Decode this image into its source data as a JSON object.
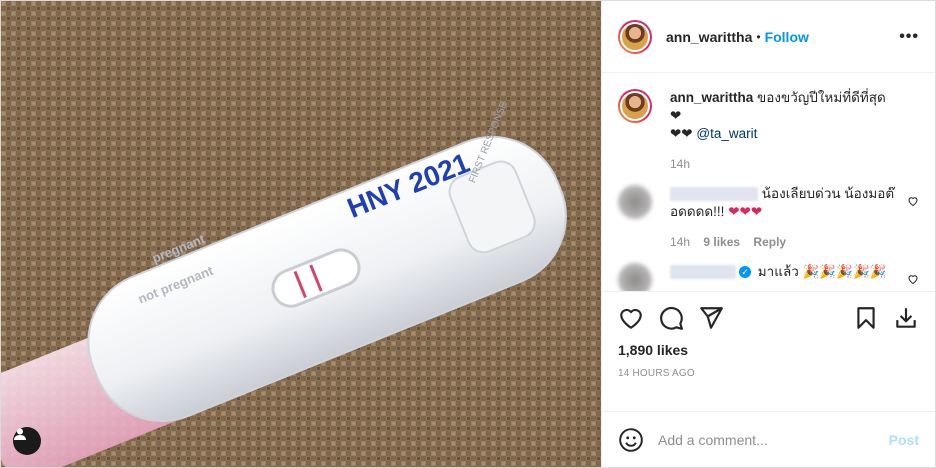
{
  "post": {
    "username": "ann_warittha",
    "follow_label": "Follow",
    "separator": "•",
    "more_label": "•••",
    "caption_user": "ann_warittha",
    "caption_text": " ของขวัญปีใหม่ที่ดีที่สุด ❤",
    "caption_line2": "❤❤ ",
    "mention": "@ta_warit",
    "caption_time": "14h",
    "likes": "1,890 likes",
    "posted": "14 HOURS AGO"
  },
  "photo": {
    "test_text_main": "HNY 2021",
    "brand_text": "FIRST RESPONSE",
    "label_pregnant": "pregnant",
    "label_not_pregnant": "not pregnant"
  },
  "comments": [
    {
      "text": "น้องเลียบด่วน น้องมอต๊อดดดด!!!",
      "hearts": "❤❤❤",
      "time": "14h",
      "likes": "9 likes",
      "reply": "Reply"
    },
    {
      "text": "มาแล้ว",
      "emoji": "🎉🎉🎉🎉🎉"
    }
  ],
  "composer": {
    "placeholder": "Add a comment...",
    "post_label": "Post"
  },
  "colors": {
    "accent": "#0095f6",
    "post_disabled": "#b2dffc",
    "heart": "#e0245e"
  },
  "icons": [
    "heart-icon",
    "comment-icon",
    "share-icon",
    "bookmark-icon",
    "download-icon",
    "smile-icon",
    "user-tag-icon",
    "more-icon"
  ]
}
